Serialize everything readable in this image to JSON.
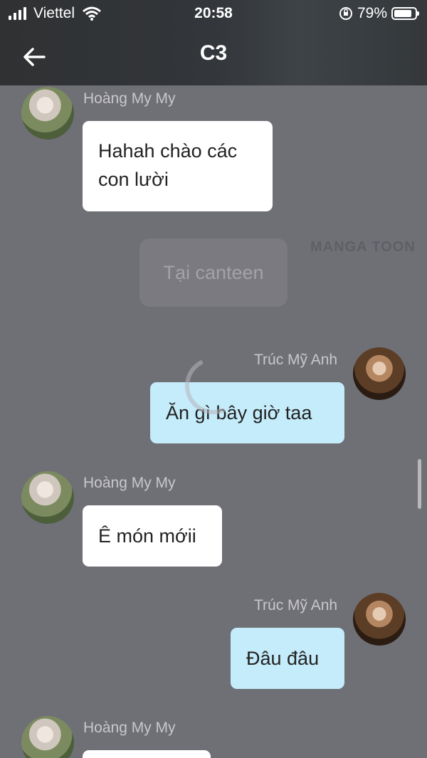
{
  "status_bar": {
    "carrier": "Viettel",
    "time": "20:58",
    "battery": "79%"
  },
  "header": {
    "title": "C3"
  },
  "watermark": "MANGA TOON",
  "messages": [
    {
      "sender": "Hoàng My My",
      "text": "Hahah chào các con lười",
      "side": "left"
    },
    {
      "system": "Tại canteen"
    },
    {
      "sender": "Trúc Mỹ Anh",
      "text": "Ăn gì bây giờ taa",
      "side": "right"
    },
    {
      "sender": "Hoàng My My",
      "text": "Ê món mớii",
      "side": "left"
    },
    {
      "sender": "Trúc Mỹ Anh",
      "text": "Đâu đâu",
      "side": "right"
    },
    {
      "sender": "Hoàng My My",
      "text": "",
      "side": "left"
    }
  ]
}
